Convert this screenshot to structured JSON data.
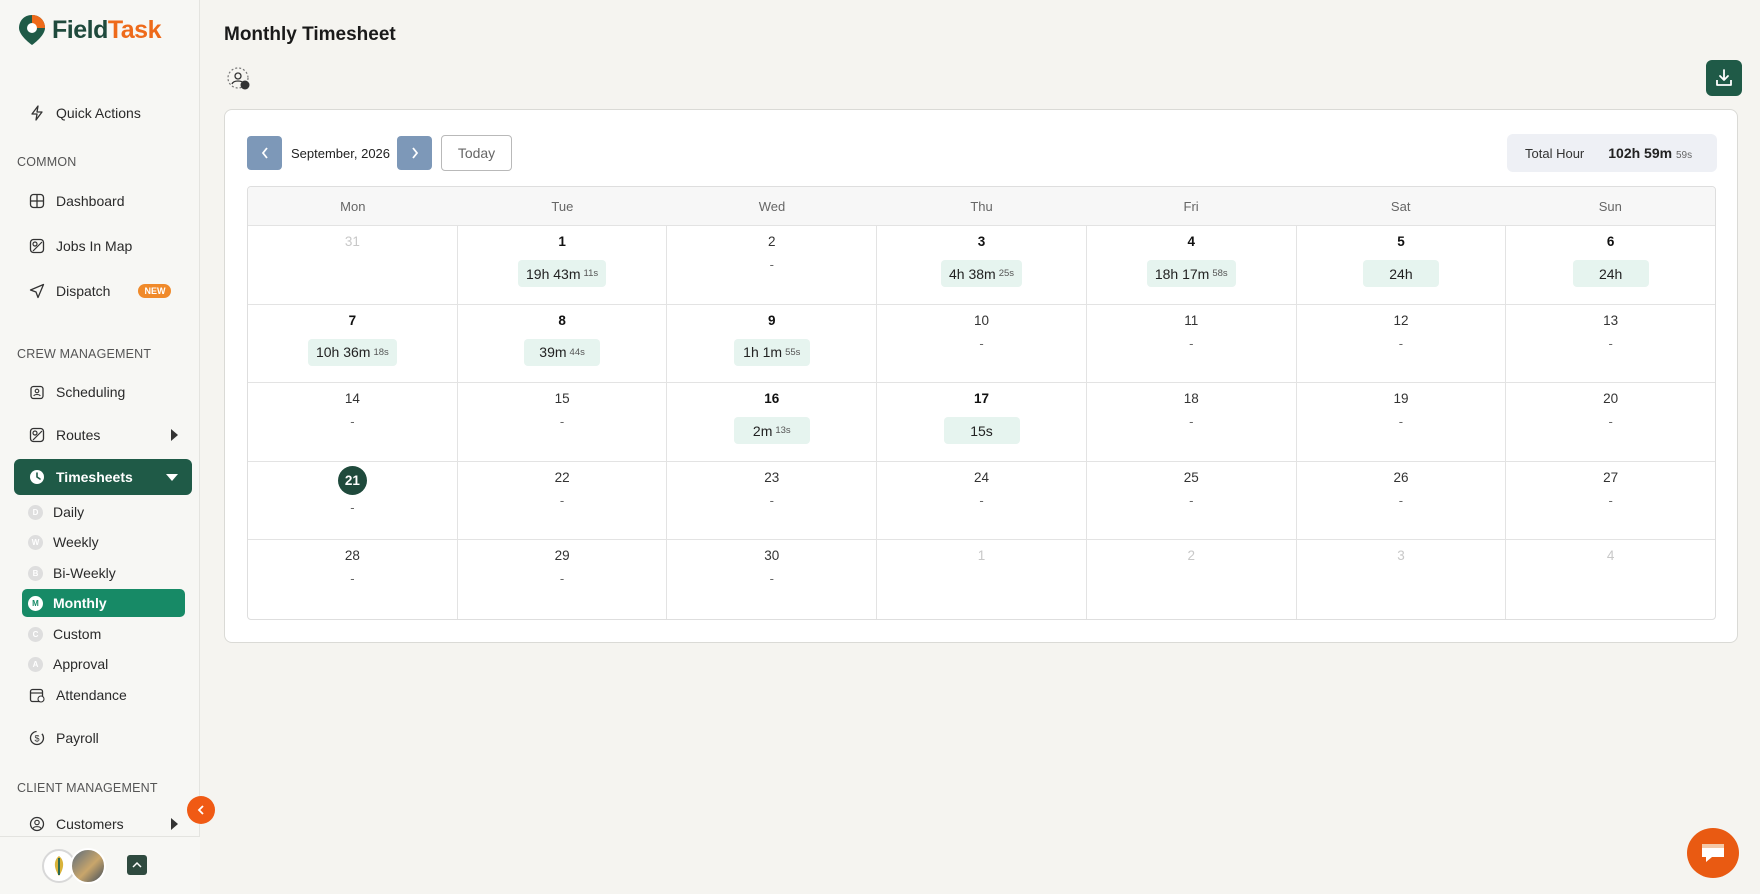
{
  "app": {
    "brand_part1": "Field",
    "brand_part2": "Task"
  },
  "sidebar": {
    "quick_actions": "Quick Actions",
    "sections": {
      "common": "COMMON",
      "crew": "CREW MANAGEMENT",
      "client": "CLIENT MANAGEMENT"
    },
    "items": {
      "dashboard": "Dashboard",
      "jobs_in_map": "Jobs In Map",
      "dispatch": "Dispatch",
      "dispatch_badge": "NEW",
      "scheduling": "Scheduling",
      "routes": "Routes",
      "timesheets": "Timesheets",
      "attendance": "Attendance",
      "payroll": "Payroll",
      "customers": "Customers"
    },
    "timesheet_sub": [
      {
        "letter": "D",
        "label": "Daily"
      },
      {
        "letter": "W",
        "label": "Weekly"
      },
      {
        "letter": "B",
        "label": "Bi-Weekly"
      },
      {
        "letter": "M",
        "label": "Monthly",
        "active": true
      },
      {
        "letter": "C",
        "label": "Custom"
      },
      {
        "letter": "A",
        "label": "Approval"
      }
    ]
  },
  "page": {
    "title": "Monthly Timesheet"
  },
  "calendar": {
    "month_label": "September, 2026",
    "today_label": "Today",
    "total_label": "Total Hour",
    "total_main": "102h 59m",
    "total_sec": "59s",
    "weekdays": [
      "Mon",
      "Tue",
      "Wed",
      "Thu",
      "Fri",
      "Sat",
      "Sun"
    ],
    "weeks": [
      [
        {
          "day": "31",
          "faded": true
        },
        {
          "day": "1",
          "bold": true,
          "hours": "19h 43m",
          "sec": "11s"
        },
        {
          "day": "2",
          "dash": "-"
        },
        {
          "day": "3",
          "bold": true,
          "hours": "4h 38m",
          "sec": "25s"
        },
        {
          "day": "4",
          "bold": true,
          "hours": "18h 17m",
          "sec": "58s"
        },
        {
          "day": "5",
          "bold": true,
          "hours": "24h",
          "sec": ""
        },
        {
          "day": "6",
          "bold": true,
          "hours": "24h",
          "sec": ""
        }
      ],
      [
        {
          "day": "7",
          "bold": true,
          "hours": "10h 36m",
          "sec": "18s"
        },
        {
          "day": "8",
          "bold": true,
          "hours": "39m",
          "sec": "44s"
        },
        {
          "day": "9",
          "bold": true,
          "hours": "1h 1m",
          "sec": "55s"
        },
        {
          "day": "10",
          "dash": "-"
        },
        {
          "day": "11",
          "dash": "-"
        },
        {
          "day": "12",
          "dash": "-"
        },
        {
          "day": "13",
          "dash": "-"
        }
      ],
      [
        {
          "day": "14",
          "dash": "-"
        },
        {
          "day": "15",
          "dash": "-"
        },
        {
          "day": "16",
          "bold": true,
          "hours": "2m",
          "sec": "13s"
        },
        {
          "day": "17",
          "bold": true,
          "hours": "15s",
          "sec": ""
        },
        {
          "day": "18",
          "dash": "-"
        },
        {
          "day": "19",
          "dash": "-"
        },
        {
          "day": "20",
          "dash": "-"
        }
      ],
      [
        {
          "day": "21",
          "today": true,
          "dash": "-"
        },
        {
          "day": "22",
          "dash": "-"
        },
        {
          "day": "23",
          "dash": "-"
        },
        {
          "day": "24",
          "dash": "-"
        },
        {
          "day": "25",
          "dash": "-"
        },
        {
          "day": "26",
          "dash": "-"
        },
        {
          "day": "27",
          "dash": "-"
        }
      ],
      [
        {
          "day": "28",
          "dash": "-"
        },
        {
          "day": "29",
          "dash": "-"
        },
        {
          "day": "30",
          "dash": "-"
        },
        {
          "day": "1",
          "faded": true
        },
        {
          "day": "2",
          "faded": true
        },
        {
          "day": "3",
          "faded": true
        },
        {
          "day": "4",
          "faded": true
        }
      ]
    ]
  },
  "icons": {
    "quick_actions": "lightning-icon",
    "dashboard": "grid-icon",
    "jobs_in_map": "map-icon",
    "dispatch": "send-icon",
    "scheduling": "calendar-icon",
    "routes": "route-icon",
    "timesheets": "clock-icon",
    "attendance": "calendar-check-icon",
    "payroll": "dollar-icon",
    "customers": "user-circle-icon",
    "download": "download-icon",
    "chat": "chat-icon"
  },
  "colors": {
    "brand_dark": "#1f5a47",
    "brand_active": "#178a66",
    "accent_orange": "#ee6a1a",
    "hours_bg": "#e6f4ef"
  }
}
